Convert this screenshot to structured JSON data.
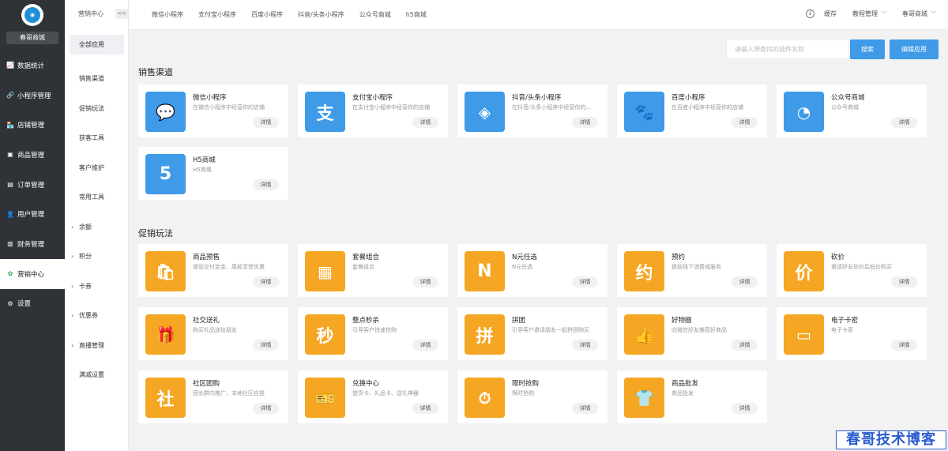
{
  "sidebar": {
    "store_name": "春哥商城",
    "items": [
      {
        "label": "数据统计",
        "icon": "chart-icon"
      },
      {
        "label": "小程序管理",
        "icon": "link-icon"
      },
      {
        "label": "店铺管理",
        "icon": "store-icon"
      },
      {
        "label": "商品管理",
        "icon": "goods-icon"
      },
      {
        "label": "订单管理",
        "icon": "order-icon"
      },
      {
        "label": "用户管理",
        "icon": "user-icon"
      },
      {
        "label": "财务管理",
        "icon": "finance-icon"
      },
      {
        "label": "营销中心",
        "icon": "marketing-icon",
        "active": true
      },
      {
        "label": "设置",
        "icon": "settings-icon"
      }
    ]
  },
  "subbar": {
    "title": "营销中心",
    "collapse": "<<",
    "items": [
      {
        "label": "全部应用",
        "active": true
      },
      {
        "label": "销售渠道"
      },
      {
        "label": "促销玩法"
      },
      {
        "label": "获客工具"
      },
      {
        "label": "客户维护"
      },
      {
        "label": "常用工具"
      },
      {
        "label": "余额",
        "arrow": true
      },
      {
        "label": "积分",
        "arrow": true
      },
      {
        "label": "卡券",
        "arrow": true
      },
      {
        "label": "优惠券",
        "arrow": true
      },
      {
        "label": "直播管理",
        "arrow": true
      },
      {
        "label": "满减设置"
      }
    ]
  },
  "topbar": {
    "tabs": [
      "微信小程序",
      "支付宝小程序",
      "百度小程序",
      "抖音/头条小程序",
      "公众号商城",
      "h5商城"
    ],
    "cache": "缓存",
    "tutorial": "教程管理",
    "store": "春哥商城"
  },
  "toolbar": {
    "search_placeholder": "请输入想查找的插件名称",
    "search_label": "搜索",
    "edit_label": "编辑应用"
  },
  "sections": [
    {
      "title": "销售渠道",
      "cards": [
        {
          "name": "微信小程序",
          "desc": "在微信小程序中经营你的店铺",
          "color": "blue",
          "icon": "wechat-icon",
          "glyph": "💬"
        },
        {
          "name": "支付宝小程序",
          "desc": "在支付宝小程序中经营你的店铺",
          "color": "blue",
          "icon": "alipay-icon",
          "glyph": "支"
        },
        {
          "name": "抖音/头条小程序",
          "desc": "在抖音/头条小程序中经营你的...",
          "color": "blue",
          "icon": "douyin-icon",
          "glyph": "◈"
        },
        {
          "name": "百度小程序",
          "desc": "在百度小程序中经营你的店铺",
          "color": "blue",
          "icon": "baidu-icon",
          "glyph": "🐾"
        },
        {
          "name": "公众号商城",
          "desc": "公众号商城",
          "color": "blue",
          "icon": "official-account-icon",
          "glyph": "◔"
        },
        {
          "name": "H5商城",
          "desc": "H5商城",
          "color": "blue",
          "icon": "html5-icon",
          "glyph": "5"
        }
      ]
    },
    {
      "title": "促销玩法",
      "cards": [
        {
          "name": "商品预售",
          "desc": "提前交付定金、尾款享受优惠",
          "color": "orange",
          "icon": "presale-bag-icon",
          "glyph": "🛍"
        },
        {
          "name": "套餐组合",
          "desc": "套餐组合",
          "color": "orange",
          "icon": "combo-icon",
          "glyph": "▦"
        },
        {
          "name": "N元任选",
          "desc": "N元任选",
          "color": "orange",
          "icon": "n-yuan-icon",
          "glyph": "N"
        },
        {
          "name": "预约",
          "desc": "提前线下消费或服务",
          "color": "orange",
          "icon": "appointment-icon",
          "glyph": "约"
        },
        {
          "name": "砍价",
          "desc": "邀请好友砍价后低价购买",
          "color": "orange",
          "icon": "bargain-icon",
          "glyph": "价"
        },
        {
          "name": "社交送礼",
          "desc": "购买礼品送给朋友",
          "color": "orange",
          "icon": "gift-icon",
          "glyph": "🎁"
        },
        {
          "name": "整点秒杀",
          "desc": "引导客户快速抢购",
          "color": "orange",
          "icon": "flash-sale-icon",
          "glyph": "秒"
        },
        {
          "name": "拼团",
          "desc": "引导客户邀请朋友一起拼团购买",
          "color": "orange",
          "icon": "group-buy-icon",
          "glyph": "拼"
        },
        {
          "name": "好物圈",
          "desc": "向微信好友推荐好商品",
          "color": "orange",
          "icon": "thumbs-up-icon",
          "glyph": "👍"
        },
        {
          "name": "电子卡密",
          "desc": "电子卡密",
          "color": "orange",
          "icon": "card-key-icon",
          "glyph": "▭"
        },
        {
          "name": "社区团购",
          "desc": "团长群内推广，本地社区自提",
          "color": "orange",
          "icon": "community-icon",
          "glyph": "社"
        },
        {
          "name": "兑换中心",
          "desc": "提货卡、礼品卡、送礼神器",
          "color": "orange",
          "icon": "exchange-icon",
          "glyph": "🎫"
        },
        {
          "name": "限时抢购",
          "desc": "限时抢购",
          "color": "orange",
          "icon": "clock-icon",
          "glyph": "⏱"
        },
        {
          "name": "商品批发",
          "desc": "商品批发",
          "color": "orange",
          "icon": "wholesale-icon",
          "glyph": "👕"
        }
      ]
    }
  ],
  "detail_label": "详情",
  "watermark": "春哥技术博客"
}
